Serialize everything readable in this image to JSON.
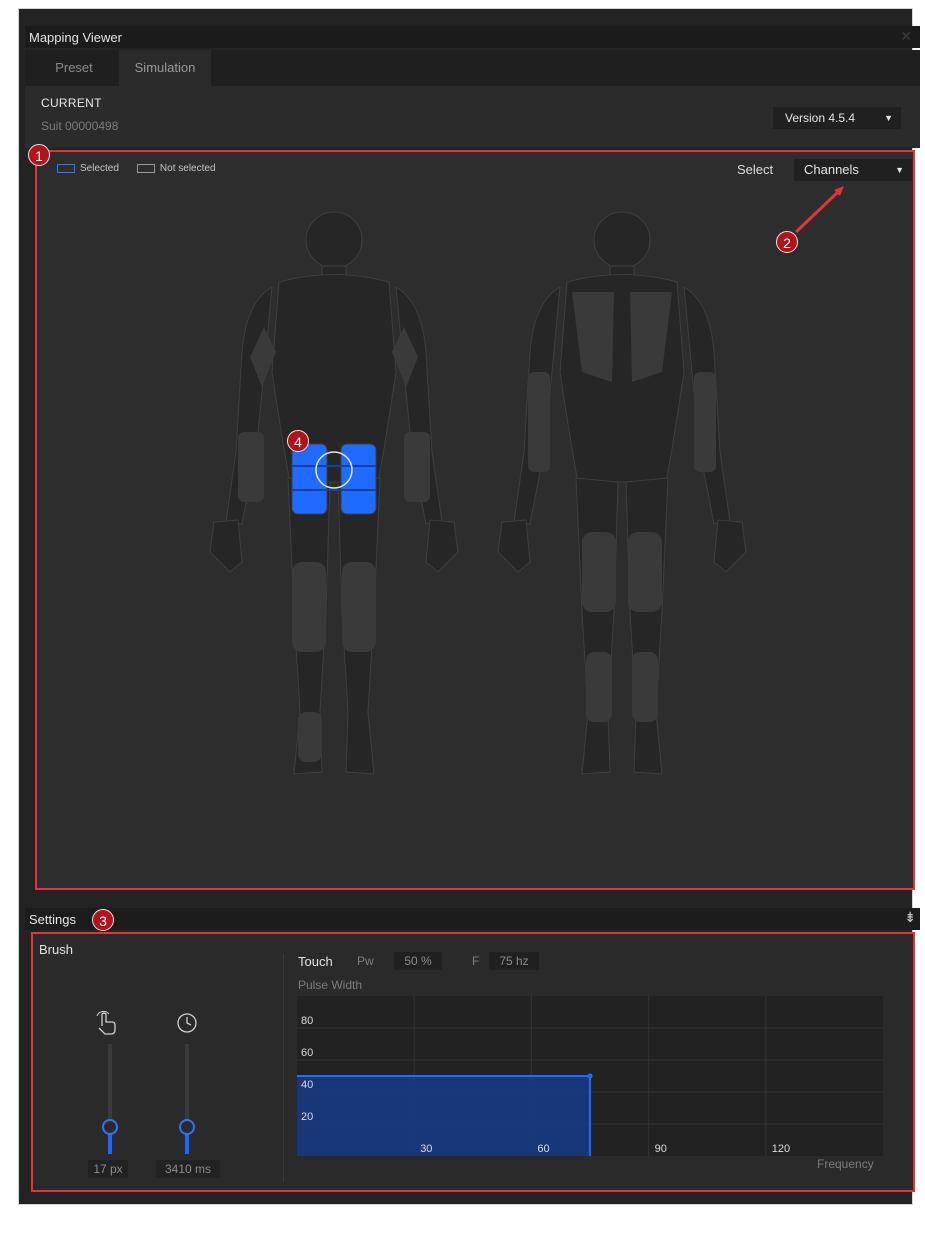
{
  "window": {
    "title": "Mapping Viewer",
    "close_icon": "close-icon"
  },
  "tabs": [
    {
      "label": "Preset"
    },
    {
      "label": "Simulation"
    }
  ],
  "current": {
    "heading": "CURRENT",
    "suit": "Suit 00000498",
    "version": "Version 4.5.4"
  },
  "viewer": {
    "legend": {
      "selected": "Selected",
      "not_selected": "Not selected"
    },
    "select_label": "Select",
    "select_value": "Channels",
    "selected_color": "#1f6bff"
  },
  "badges": {
    "b1": "1",
    "b2": "2",
    "b3": "3",
    "b4": "4"
  },
  "settings": {
    "label": "Settings",
    "brush_label": "Brush",
    "size_icon": "touch-hand-icon",
    "time_icon": "clock-icon",
    "size_value": "17 px",
    "time_value": "3410 ms",
    "size_level": 0.25,
    "time_level": 0.25,
    "touch_label": "Touch",
    "pw_label": "Pw",
    "pw_value": "50 %",
    "f_label": "F",
    "f_value": "75 hz",
    "pulse_width_label": "Pulse Width",
    "frequency_label": "Frequency"
  },
  "chart_data": {
    "type": "area",
    "ylabel": "Pulse Width",
    "xlabel": "Frequency",
    "x_ticks": [
      "30",
      "60",
      "90",
      "120"
    ],
    "y_ticks": [
      "20",
      "40",
      "60",
      "80"
    ],
    "xlim": [
      0,
      150
    ],
    "ylim": [
      0,
      100
    ],
    "x": [
      0,
      75
    ],
    "values": [
      50,
      50
    ]
  }
}
